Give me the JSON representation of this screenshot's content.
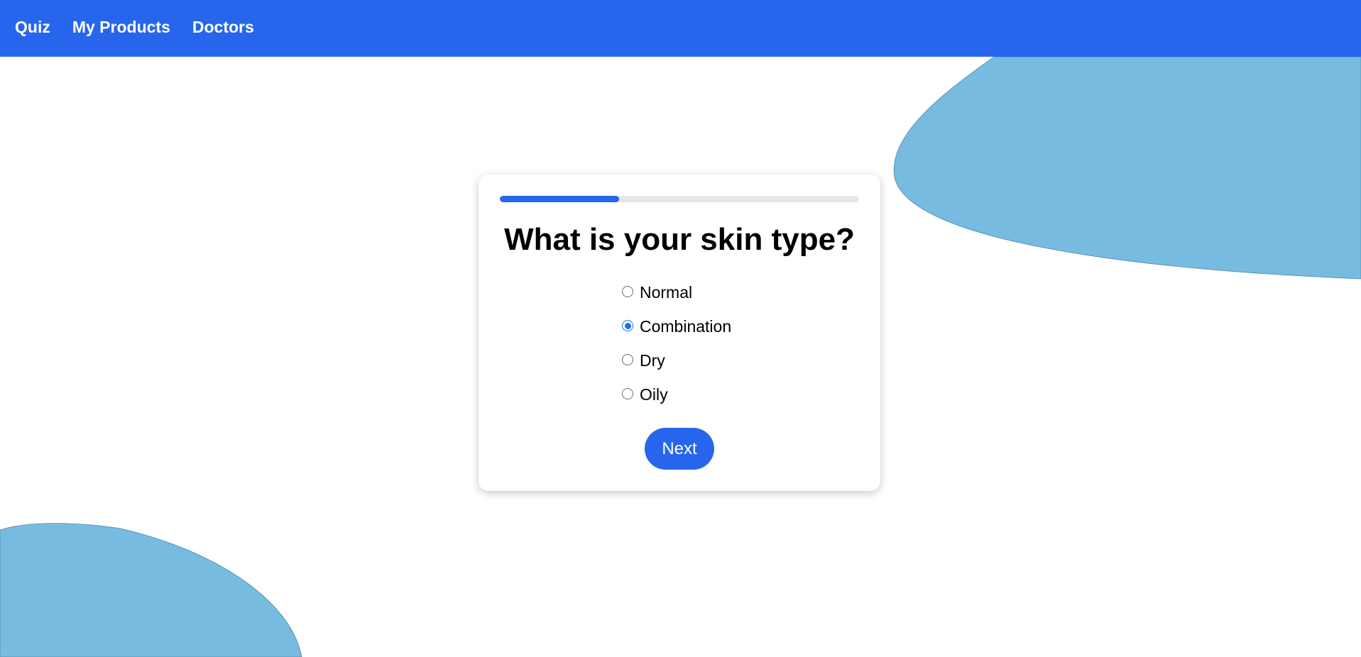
{
  "nav": {
    "items": [
      {
        "label": "Quiz"
      },
      {
        "label": "My Products"
      },
      {
        "label": "Doctors"
      }
    ]
  },
  "quiz": {
    "progress_fraction": 0.333,
    "question": "What is your skin type?",
    "options": [
      {
        "label": "Normal",
        "checked": false
      },
      {
        "label": "Combination",
        "checked": true
      },
      {
        "label": "Dry",
        "checked": false
      },
      {
        "label": "Oily",
        "checked": false
      }
    ],
    "next_label": "Next"
  },
  "colors": {
    "primary": "#2766ec",
    "blob": "#78bbe0",
    "track": "#e6e6e6",
    "radio_checked": "#1a73e8"
  }
}
